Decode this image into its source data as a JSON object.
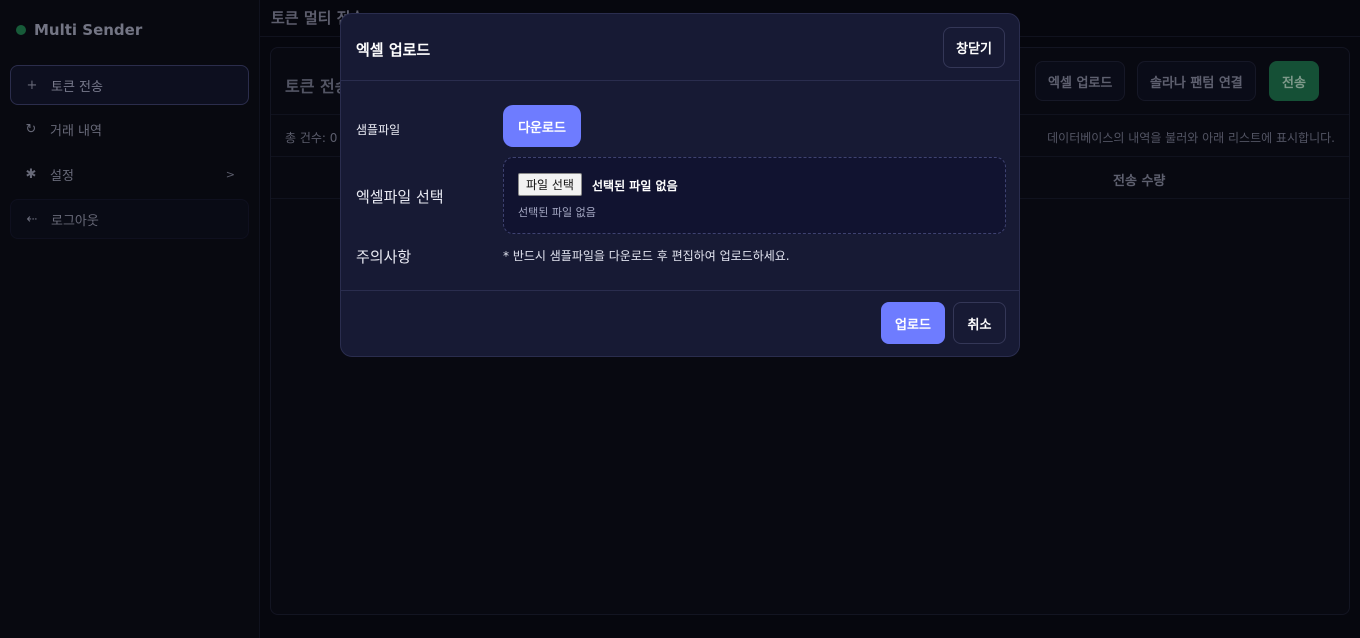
{
  "app": {
    "brand": "Multi Sender",
    "page_title": "토큰 멀티 전송"
  },
  "sidebar": {
    "items": [
      {
        "label": "토큰 전송",
        "icon": "plus-icon"
      },
      {
        "label": "거래 내역",
        "icon": "history-icon"
      },
      {
        "label": "설정",
        "icon": "gear-icon",
        "chevron": ">"
      },
      {
        "label": "로그아웃",
        "icon": "logout-icon"
      }
    ]
  },
  "panel": {
    "title": "토큰 전송",
    "buttons": {
      "excel_upload": "엑셀 업로드",
      "wallet_connect": "솔라나 팬텀 연결",
      "send": "전송"
    },
    "total_count": "총 건수: 0",
    "info": "데이터베이스의 내역을 불러와 아래 리스트에 표시합니다.",
    "columns": {
      "amount": "전송 수량"
    }
  },
  "modal": {
    "title": "엑셀 업로드",
    "close_label": "창닫기",
    "sample_label": "샘플파일",
    "download_label": "다운로드",
    "select_label": "엑셀파일 선택",
    "file_button": "파일 선택",
    "file_none": "선택된 파일 없음",
    "file_status": "선택된 파일 없음",
    "notice_label": "주의사항",
    "notice_text": "* 반드시 샘플파일을 다운로드 후 편집하여 업로드하세요.",
    "upload_label": "업로드",
    "cancel_label": "취소"
  },
  "colors": {
    "accent": "#6e7cff",
    "success": "#1d6b48",
    "modal_bg": "#171a34",
    "page_bg": "#090a13"
  }
}
